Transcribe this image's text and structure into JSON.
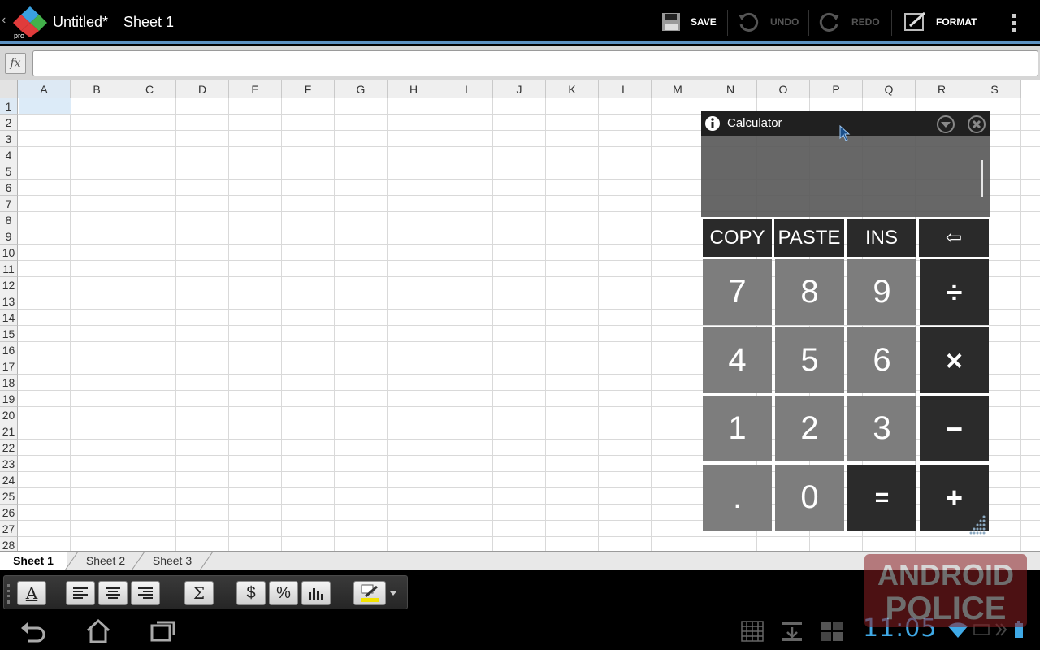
{
  "actionbar": {
    "back_glyph": "‹",
    "title": "Untitled*",
    "sheet_name": "Sheet 1",
    "save_label": "SAVE",
    "undo_label": "UNDO",
    "redo_label": "REDO",
    "format_label": "FORMAT",
    "accent_color": "#5c91c2"
  },
  "formula_bar": {
    "fx_label": "fx",
    "value": ""
  },
  "grid": {
    "columns": [
      "A",
      "B",
      "C",
      "D",
      "E",
      "F",
      "G",
      "H",
      "I",
      "J",
      "K",
      "L",
      "M",
      "N",
      "O",
      "P",
      "Q",
      "R",
      "S"
    ],
    "rows": [
      "1",
      "2",
      "3",
      "4",
      "5",
      "6",
      "7",
      "8",
      "9",
      "10",
      "11",
      "12",
      "13",
      "14",
      "15",
      "16",
      "17",
      "18",
      "19",
      "20",
      "21",
      "22",
      "23",
      "24",
      "25",
      "26",
      "27",
      "28"
    ],
    "selected_cell": "A1"
  },
  "sheet_tabs": [
    {
      "label": "Sheet 1",
      "active": true
    },
    {
      "label": "Sheet 2",
      "active": false
    },
    {
      "label": "Sheet 3",
      "active": false
    }
  ],
  "calculator": {
    "title": "Calculator",
    "display": "",
    "top_keys": [
      "COPY",
      "PASTE",
      "INS",
      "⇦"
    ],
    "number_keys": [
      [
        "7",
        "8",
        "9"
      ],
      [
        "4",
        "5",
        "6"
      ],
      [
        "1",
        "2",
        "3"
      ],
      [
        ".",
        "0"
      ]
    ],
    "op_keys": [
      "÷",
      "×",
      "−",
      "+"
    ],
    "equals_key": "="
  },
  "toolbar": {
    "font_glyph": "A",
    "sum_glyph": "Σ",
    "currency_glyph": "$",
    "percent_glyph": "%"
  },
  "status": {
    "time": "11:05"
  },
  "icons": [
    "app-logo-icon",
    "save-icon",
    "undo-icon",
    "redo-icon",
    "format-icon",
    "overflow-menu-icon",
    "info-icon",
    "minimize-icon",
    "close-icon",
    "back-icon",
    "home-icon",
    "recent-apps-icon",
    "wifi-icon",
    "battery-icon"
  ],
  "watermark": "ANDROID POLICE"
}
